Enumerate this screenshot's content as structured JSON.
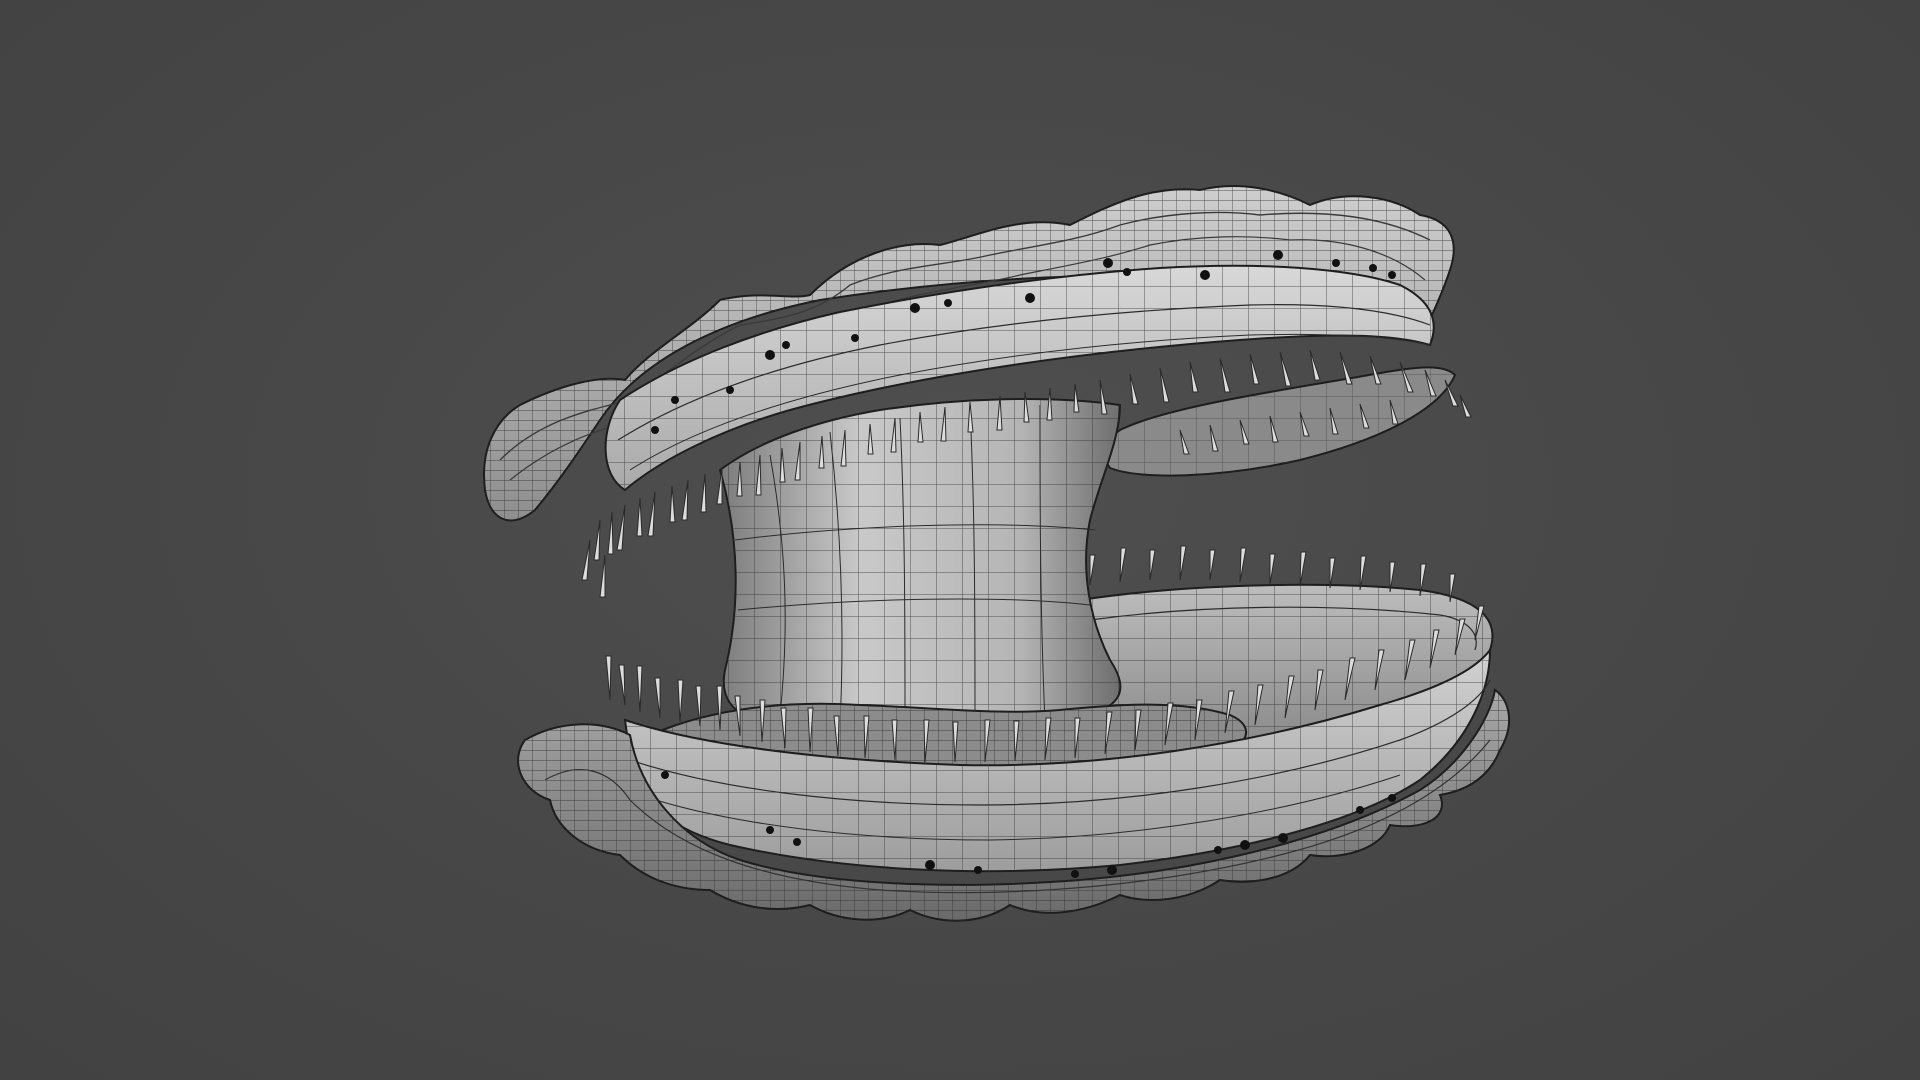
{
  "viewport": {
    "background": "#474747",
    "subject": "scallop-shell-wireframe-model",
    "shading": "grey-shaded-with-wireframe"
  },
  "colors": {
    "shell_light": "#c8c8c8",
    "shell_mid": "#9a9a9a",
    "shell_dark": "#5a5a5a",
    "wire": "#1e1e1e",
    "tentacle": "#dcdcdc",
    "eye": "#111111"
  }
}
